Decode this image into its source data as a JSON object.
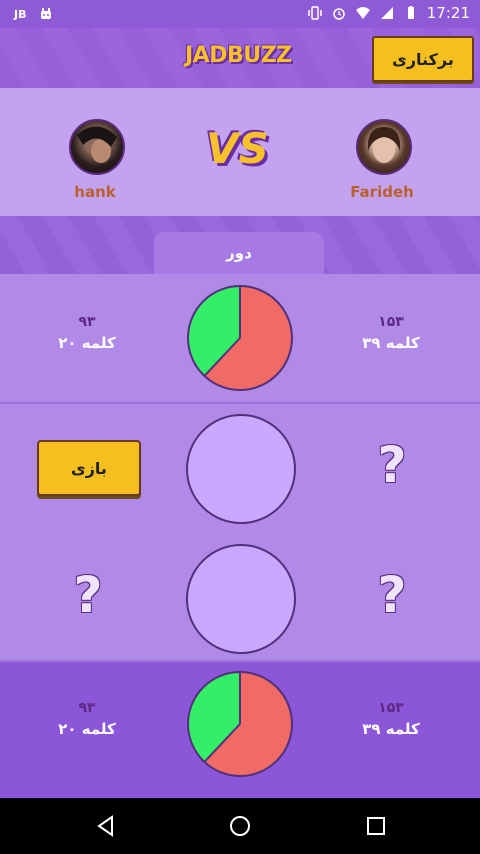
{
  "status_bar": {
    "left_text": "JB",
    "time": "17:21"
  },
  "header": {
    "logo_text": "JADBUZZ",
    "quit_label": "برکناری"
  },
  "players": {
    "left": {
      "name": "hank"
    },
    "right": {
      "name": "Farideh"
    },
    "vs_text": "VS"
  },
  "tab_label": "دور",
  "rounds": [
    {
      "left": {
        "score": "۹۳",
        "words": "۲۰ کلمه"
      },
      "right": {
        "score": "۱۵۳",
        "words": "۳۹ کلمه"
      },
      "pie": {
        "green_fraction": 0.38,
        "green": "#33ee66",
        "red": "#f06a66"
      }
    },
    {
      "left": {
        "button": "بازی"
      },
      "right": {
        "symbol": "?"
      }
    },
    {
      "left": {
        "symbol": "?"
      },
      "right": {
        "symbol": "?"
      }
    },
    {
      "left": {
        "score": "۹۳",
        "words": "۲۰ کلمه"
      },
      "right": {
        "score": "۱۵۳",
        "words": "۳۹ کلمه"
      },
      "pie": {
        "green_fraction": 0.38,
        "green": "#33ee66",
        "red": "#f06a66"
      }
    }
  ],
  "colors": {
    "accent": "#f5bf20",
    "purple": "#8f5ad6"
  }
}
